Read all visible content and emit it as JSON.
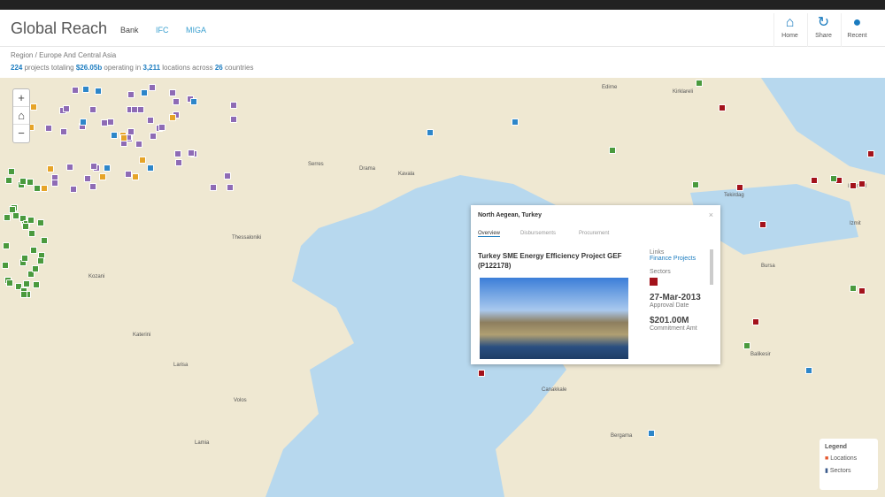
{
  "header": {
    "title": "Global Reach",
    "institutions": [
      {
        "label": "Bank",
        "active": true
      },
      {
        "label": "IFC",
        "active": false
      },
      {
        "label": "MIGA",
        "active": false
      }
    ],
    "buttons": [
      {
        "label": "Home",
        "icon": "home-icon"
      },
      {
        "label": "Share",
        "icon": "share-icon"
      },
      {
        "label": "Recent",
        "icon": "map-pin-icon"
      }
    ]
  },
  "breadcrumb": {
    "root": "Region",
    "sep": "/",
    "current": "Europe And Central Asia"
  },
  "stats": {
    "projects": "224",
    "t1": " projects totaling ",
    "total": "$26.05b",
    "t2": " operating in ",
    "locations": "3,211",
    "t3": " locations across ",
    "countries": "26",
    "t4": " countries"
  },
  "map": {
    "zoom_in": "+",
    "home": "⌂",
    "zoom_out": "−",
    "places": [
      "Edirne",
      "Kirklareli",
      "Istanbul",
      "Tekirdag",
      "Thessaloniki",
      "Kavala",
      "Drama",
      "Serres",
      "Larisa",
      "Volos",
      "Katerini",
      "Kozani",
      "Balikesir",
      "Bergama",
      "Bursa",
      "Canakkale",
      "Izmit",
      "Lamia"
    ]
  },
  "popup": {
    "location": "North Aegean, Turkey",
    "close": "×",
    "tabs": [
      "Overview",
      "Disbursements",
      "Procurement"
    ],
    "project": "Turkey SME Energy Efficiency Project GEF (P122178)",
    "links_label": "Links",
    "link": "Finance Projects",
    "sectors_label": "Sectors",
    "date": "27-Mar-2013",
    "date_label": "Approval Date",
    "amount": "$201.00M",
    "amount_label": "Commitment Amt"
  },
  "legend": {
    "title": "Legend",
    "items": [
      "Locations",
      "Sectors"
    ]
  },
  "colors": {
    "accent": "#1a7bbf",
    "sea": "#b7d8ee",
    "land": "#efe8d2",
    "marker_purple": "#8e6bb5",
    "marker_green": "#4a9a3e",
    "marker_red": "#a3121b",
    "marker_orange": "#e6a428",
    "marker_blue": "#2d86c9"
  }
}
